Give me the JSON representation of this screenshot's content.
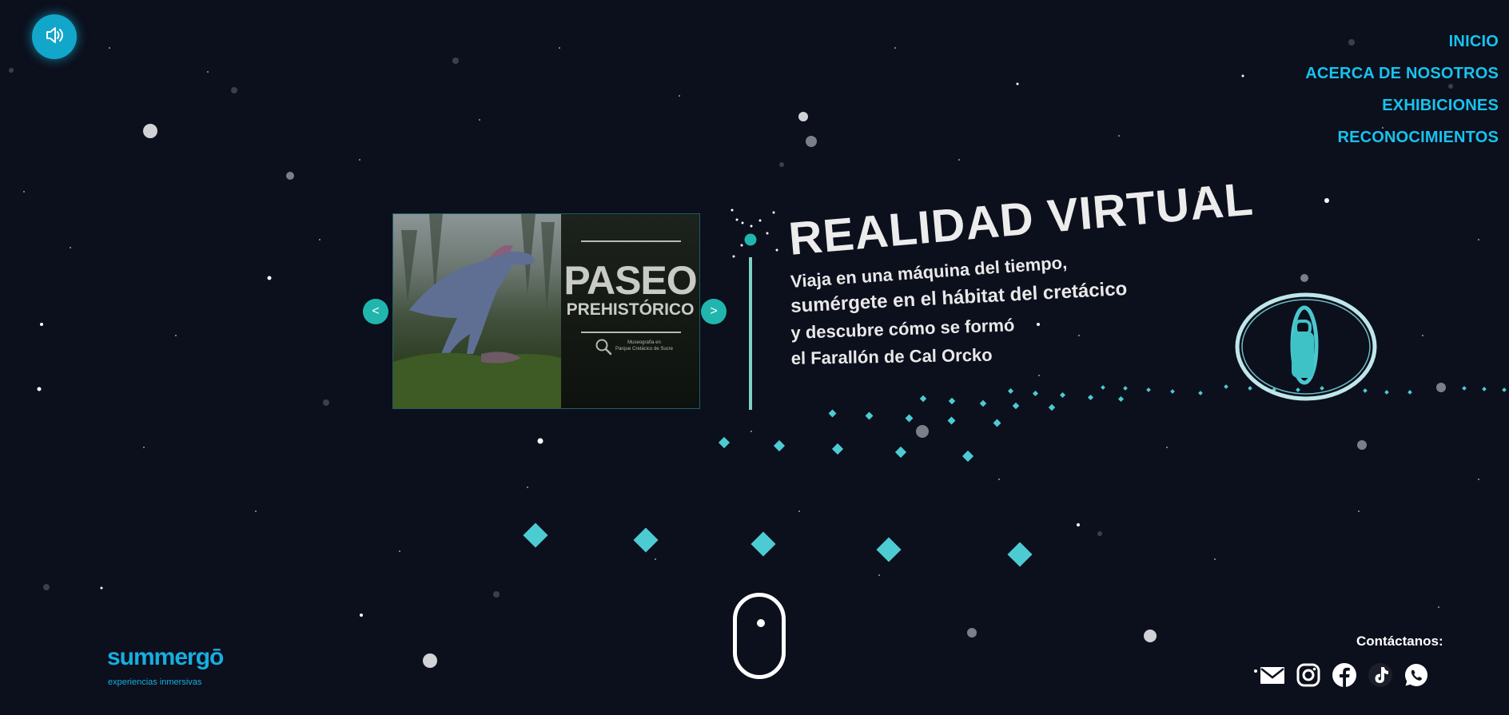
{
  "sound_button": {
    "icon": "speaker-icon"
  },
  "nav": {
    "items": [
      {
        "label": "INICIO"
      },
      {
        "label": "ACERCA DE NOSOTROS"
      },
      {
        "label": "EXHIBICIONES"
      },
      {
        "label": "RECONOCIMIENTOS"
      }
    ]
  },
  "carousel": {
    "prev_label": "<",
    "next_label": ">",
    "slide": {
      "title": "PASEO",
      "subtitle": "PREHISTÓRICO",
      "caption_line1": "Museografía en",
      "caption_line2": "Parque Cretácico de Sucre"
    }
  },
  "hero": {
    "title": "REALIDAD VIRTUAL",
    "lines": [
      "Viaja en una máquina del tiempo,",
      "sumérgete en el hábitat del cretácico",
      "y descubre cómo se formó",
      "el Farallón de Cal Orcko"
    ]
  },
  "logo": {
    "name": "summergō",
    "tagline": "experiencias inmersivas"
  },
  "contact": {
    "label": "Contáctanos:",
    "icons": [
      "mail-icon",
      "instagram-icon",
      "facebook-icon",
      "tiktok-icon",
      "whatsapp-icon"
    ]
  },
  "colors": {
    "background": "#0c0f1c",
    "accent": "#17c3ee",
    "teal": "#20b6ae",
    "diamond": "#4ccbd3"
  }
}
